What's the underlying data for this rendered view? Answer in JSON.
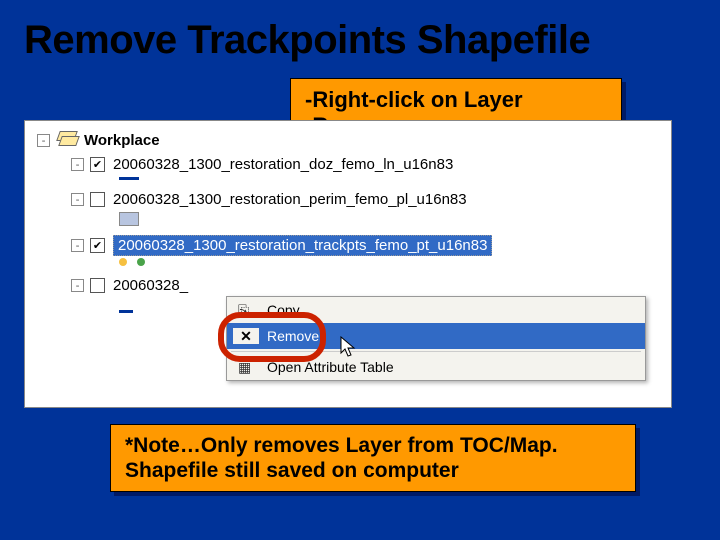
{
  "title": "Remove Trackpoints Shapefile",
  "callout_top": {
    "line1": "-Right-click on Layer",
    "line2": "-Remove"
  },
  "callout_bottom": {
    "line1": "*Note…Only removes Layer from TOC/Map.",
    "line2": "Shapefile still saved on computer"
  },
  "toc": {
    "root": "Workplace",
    "layers": [
      {
        "name": "20060328_1300_restoration_doz_femo_ln_u16n83",
        "checked": true
      },
      {
        "name": "20060328_1300_restoration_perim_femo_pl_u16n83",
        "checked": false
      },
      {
        "name": "20060328_1300_restoration_trackpts_femo_pt_u16n83",
        "checked": true,
        "selected": true
      },
      {
        "name": "20060328_",
        "checked": false
      }
    ]
  },
  "menu": {
    "copy": "Copy",
    "remove": "Remove",
    "open_table": "Open Attribute Table"
  }
}
